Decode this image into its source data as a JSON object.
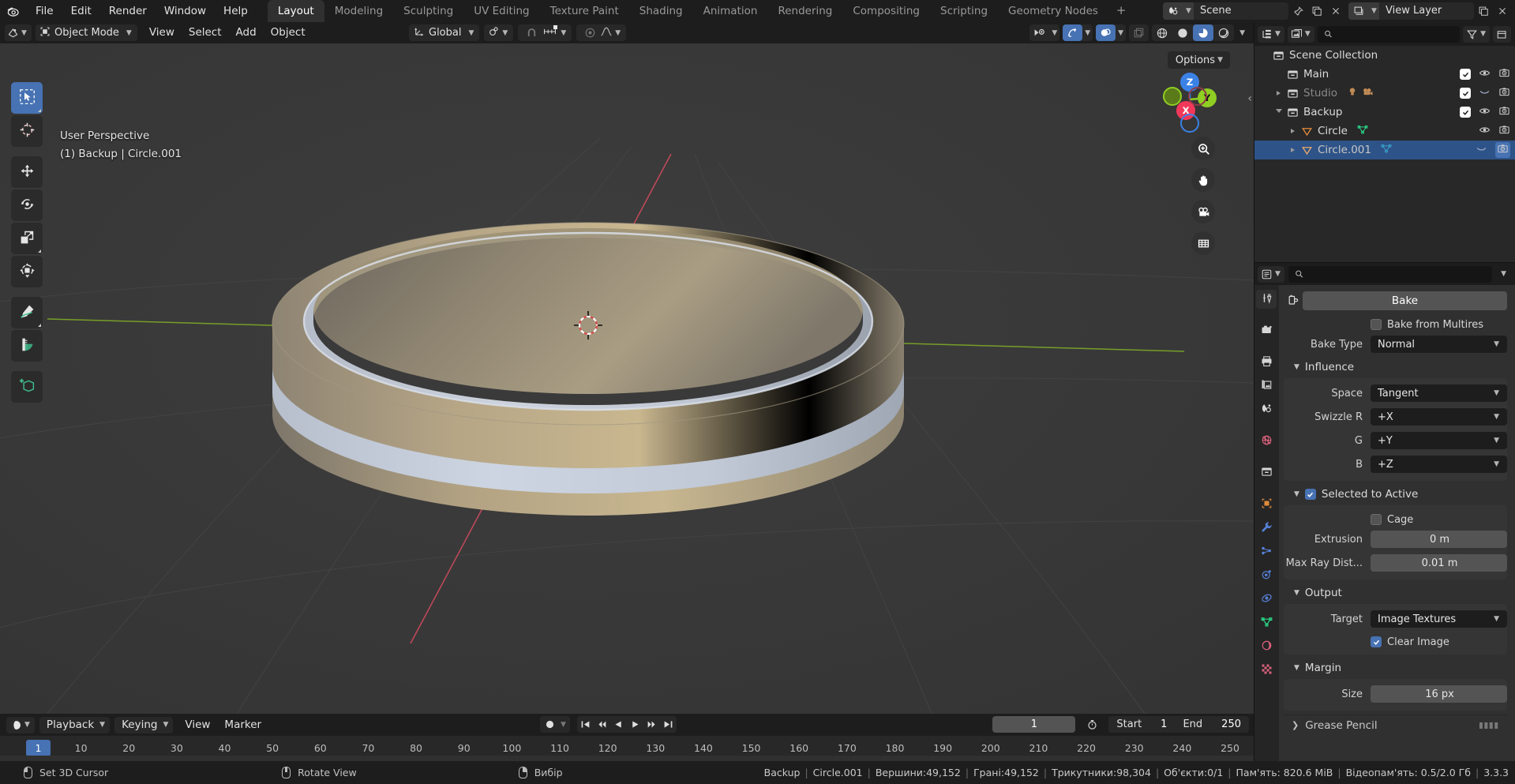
{
  "app": {
    "name": "Blender",
    "version": "3.3.3"
  },
  "topbar": {
    "logo_icon": "blender-logo-icon",
    "menus": [
      "File",
      "Edit",
      "Render",
      "Window",
      "Help"
    ],
    "workspace_tabs": [
      {
        "label": "Layout",
        "active": true
      },
      {
        "label": "Modeling",
        "active": false
      },
      {
        "label": "Sculpting",
        "active": false
      },
      {
        "label": "UV Editing",
        "active": false
      },
      {
        "label": "Texture Paint",
        "active": false
      },
      {
        "label": "Shading",
        "active": false
      },
      {
        "label": "Animation",
        "active": false
      },
      {
        "label": "Rendering",
        "active": false
      },
      {
        "label": "Compositing",
        "active": false
      },
      {
        "label": "Scripting",
        "active": false
      },
      {
        "label": "Geometry Nodes",
        "active": false
      }
    ],
    "add_tab_label": "+",
    "scene_name": "Scene",
    "view_layer_name": "View Layer",
    "scene_icon": "scene-icon",
    "viewlayer_icon": "view-layer-icon",
    "pin_icon": "pin-icon",
    "new_scene_icon": "new-scene-icon",
    "remove_scene_icon": "remove-scene-icon",
    "new_layer_icon": "new-layer-icon",
    "remove_layer_icon": "remove-layer-icon"
  },
  "viewport_header": {
    "editor_type_icon": "editor-type-3dview-icon",
    "mode": "Object Mode",
    "mode_icon": "object-mode-icon",
    "menus": [
      "View",
      "Select",
      "Add",
      "Object"
    ],
    "transform_orientation": "Global",
    "transform_orientation_icon": "orientation-gizmo-icon",
    "pivot_icon": "pivot-point-icon",
    "snap_magnet_icon": "snap-magnet-icon",
    "snap_to_icon": "snap-increment-icon",
    "proportional_edit_icon": "proportional-edit-icon",
    "proportional_falloff_icon": "falloff-curve-icon",
    "visibility_icon": "object-visibility-icon",
    "gizmo_icon": "gizmo-icon",
    "overlays_icon": "overlays-icon",
    "xray_icon": "xray-toggle-icon",
    "shading_modes": [
      {
        "name": "wireframe-shading-icon",
        "active": false
      },
      {
        "name": "solid-shading-icon",
        "active": false
      },
      {
        "name": "material-preview-shading-icon",
        "active": true
      },
      {
        "name": "rendered-shading-icon",
        "active": false
      }
    ],
    "options_label": "Options"
  },
  "viewport": {
    "overlay_line1": "User Perspective",
    "overlay_line2": "(1) Backup | Circle.001",
    "gizmo_axes": [
      {
        "label": "Z",
        "color": "#3b82e6",
        "filled": true
      },
      {
        "label": "Y",
        "color": "#8fce22",
        "filled": true
      },
      {
        "label": "X",
        "color": "#f2385a",
        "filled": true
      },
      {
        "label": "",
        "color": "#8fce22",
        "filled": false
      },
      {
        "label": "",
        "color": "#f2385a",
        "filled": false
      },
      {
        "label": "",
        "color": "#3b82e6",
        "filled": false
      }
    ],
    "nav_buttons": [
      "zoom-view-icon",
      "move-view-icon",
      "camera-view-icon",
      "toggle-perspective-icon"
    ],
    "collapse_sidebar_icon": "chevron-left-icon",
    "tools": [
      {
        "name": "tweak-select-box-tool",
        "icon": "select-box-icon",
        "active": true
      },
      {
        "name": "cursor-tool",
        "icon": "3d-cursor-icon",
        "active": false
      },
      {
        "name": "move-tool",
        "icon": "move-arrows-icon",
        "active": false
      },
      {
        "name": "rotate-tool",
        "icon": "rotate-icon",
        "active": false
      },
      {
        "name": "scale-tool",
        "icon": "scale-icon",
        "active": false
      },
      {
        "name": "transform-tool",
        "icon": "transform-icon",
        "active": false
      },
      {
        "name": "annotate-tool",
        "icon": "annotate-pencil-icon",
        "active": false
      },
      {
        "name": "measure-tool",
        "icon": "measure-ruler-icon",
        "active": false
      },
      {
        "name": "add-cube-tool",
        "icon": "add-cube-icon",
        "active": false
      }
    ],
    "cursor_icon": "3d-cursor-marker",
    "object_colors": {
      "gold_band": "#bfa87e",
      "silver_band": "#c6cedd",
      "background": "#393939",
      "x_axis_line": "#cc4a5c",
      "y_axis_line": "#7ba428"
    }
  },
  "outliner": {
    "display_mode_icon": "outliner-display-mode-icon",
    "filter_id_icon": "filter-id-type-icon",
    "search_placeholder": "",
    "search_value": "",
    "search_icon": "search-icon",
    "filter_icon": "filter-funnel-icon",
    "new_collection_icon": "new-collection-icon",
    "rows": [
      {
        "label": "Scene Collection",
        "icon": "collection-icon",
        "indent": 0,
        "expander": "none",
        "selected": false,
        "dim": false,
        "checkbox": false,
        "eye": "none",
        "camera": false,
        "extra_icons": []
      },
      {
        "label": "Main",
        "icon": "collection-icon",
        "indent": 1,
        "expander": "none",
        "selected": false,
        "dim": false,
        "checkbox": true,
        "eye": "open",
        "camera": true,
        "extra_icons": []
      },
      {
        "label": "Studio",
        "icon": "collection-icon",
        "indent": 1,
        "expander": "right",
        "selected": false,
        "dim": true,
        "checkbox": true,
        "eye": "closed",
        "camera": true,
        "extra_icons": [
          "light-icon",
          "camera-data-icon"
        ]
      },
      {
        "label": "Backup",
        "icon": "collection-icon",
        "indent": 1,
        "expander": "down",
        "selected": false,
        "dim": false,
        "checkbox": true,
        "eye": "open",
        "camera": true,
        "extra_icons": []
      },
      {
        "label": "Circle",
        "icon": "mesh-object-icon",
        "indent": 2,
        "expander": "right",
        "selected": false,
        "dim": false,
        "checkbox": false,
        "eye": "open",
        "camera": true,
        "extra_icons": [
          "mesh-data-icon"
        ]
      },
      {
        "label": "Circle.001",
        "icon": "mesh-object-icon",
        "indent": 2,
        "expander": "right",
        "selected": true,
        "dim": false,
        "checkbox": false,
        "eye": "closed",
        "camera": true,
        "extra_icons": [
          "mesh-data-icon"
        ]
      }
    ]
  },
  "properties": {
    "editor_icon": "properties-editor-icon",
    "search_placeholder": "",
    "search_value": "",
    "tabs": [
      {
        "name": "tool-tab",
        "icon": "tool-screwdriver-wrench-icon",
        "active": true,
        "color": "#d6d6d6"
      },
      {
        "name": "render-tab",
        "icon": "render-camera-back-icon",
        "active": false,
        "color": "#d6d6d6"
      },
      {
        "name": "output-tab",
        "icon": "output-printer-icon",
        "active": false,
        "color": "#d6d6d6"
      },
      {
        "name": "view-layer-tab",
        "icon": "view-layer-images-icon",
        "active": false,
        "color": "#d6d6d6"
      },
      {
        "name": "scene-tab",
        "icon": "scene-cone-icon",
        "active": false,
        "color": "#d6d6d6"
      },
      {
        "name": "world-tab",
        "icon": "world-globe-icon",
        "active": false,
        "color": "#d9607a"
      },
      {
        "name": "collection-tab",
        "icon": "collection-box-icon",
        "active": false,
        "color": "#d6d6d6"
      },
      {
        "name": "object-tab",
        "icon": "object-square-icon",
        "active": false,
        "color": "#e08a3c"
      },
      {
        "name": "modifier-tab",
        "icon": "modifier-wrench-icon",
        "active": false,
        "color": "#5680d8"
      },
      {
        "name": "particles-tab",
        "icon": "particles-icon",
        "active": false,
        "color": "#5680d8"
      },
      {
        "name": "physics-tab",
        "icon": "physics-orbit-icon",
        "active": false,
        "color": "#5680d8"
      },
      {
        "name": "constraints-tab",
        "icon": "constraints-icon",
        "active": false,
        "color": "#5680d8"
      },
      {
        "name": "data-tab",
        "icon": "mesh-data-triangle-icon",
        "active": false,
        "color": "#2bd98a"
      },
      {
        "name": "material-tab",
        "icon": "material-sphere-icon",
        "active": false,
        "color": "#d9607a"
      },
      {
        "name": "texture-tab",
        "icon": "texture-checker-icon",
        "active": false,
        "color": "#d9607a"
      }
    ],
    "bake_button": {
      "label": "Bake",
      "icon": "bake-render-icon"
    },
    "bake_from_multires": {
      "label": "Bake from Multires",
      "checked": false
    },
    "bake_type": {
      "label": "Bake Type",
      "value": "Normal"
    },
    "sections": [
      {
        "title": "Influence",
        "expanded": true,
        "rows": [
          {
            "label": "Space",
            "value": "Tangent",
            "type": "dropdown"
          },
          {
            "label": "Swizzle R",
            "value": "+X",
            "type": "dropdown"
          },
          {
            "label": "G",
            "value": "+Y",
            "type": "dropdown"
          },
          {
            "label": "B",
            "value": "+Z",
            "type": "dropdown"
          }
        ]
      },
      {
        "title": "Selected to Active",
        "expanded": true,
        "checked": true,
        "rows": [
          {
            "label": "Cage",
            "value": "",
            "type": "checkbox",
            "checked": false
          },
          {
            "label": "Extrusion",
            "value": "0 m",
            "type": "value"
          },
          {
            "label": "Max Ray Dist...",
            "value": "0.01 m",
            "type": "value"
          }
        ]
      },
      {
        "title": "Output",
        "expanded": true,
        "rows": [
          {
            "label": "Target",
            "value": "Image Textures",
            "type": "dropdown"
          },
          {
            "label": "Clear Image",
            "value": "",
            "type": "checkbox",
            "checked": true
          }
        ]
      },
      {
        "title": "Margin",
        "expanded": true,
        "rows": [
          {
            "label": "Size",
            "value": "16 px",
            "type": "value"
          }
        ]
      }
    ],
    "grease_pencil": {
      "label": "Grease Pencil",
      "expanded": false
    }
  },
  "timeline": {
    "editor_icon": "timeline-editor-icon",
    "menus": [
      "Playback",
      "Keying",
      "View",
      "Marker"
    ],
    "auto_key_icon": "record-auto-key-icon",
    "transport_buttons": [
      "jump-to-start-icon",
      "jump-to-keyframe-prev-icon",
      "play-reverse-icon",
      "play-icon",
      "jump-to-keyframe-next-icon",
      "jump-to-end-icon"
    ],
    "current_frame": "1",
    "frame_range_icon": "use-preview-range-icon",
    "start_label": "Start",
    "start_value": "1",
    "end_label": "End",
    "end_value": "250",
    "playhead_frame": "1",
    "ticks": [
      1,
      10,
      20,
      30,
      40,
      50,
      60,
      70,
      80,
      90,
      100,
      110,
      120,
      130,
      140,
      150,
      160,
      170,
      180,
      190,
      200,
      210,
      220,
      230,
      240,
      250
    ]
  },
  "statusbar": {
    "keymap_hints": [
      {
        "mouse": "left",
        "label": "Set 3D Cursor"
      },
      {
        "mouse": "middle",
        "label": "Rotate View"
      },
      {
        "mouse": "right",
        "label": "Вибір"
      }
    ],
    "stats": [
      "Backup",
      "Circle.001",
      "Вершини:49,152",
      "Грані:49,152",
      "Трикутники:98,304",
      "Об'єкти:0/1",
      "Пам'ять: 820.6 MiB",
      "Відеопам'ять: 0.5/2.0 Гб",
      "3.3.3"
    ]
  }
}
